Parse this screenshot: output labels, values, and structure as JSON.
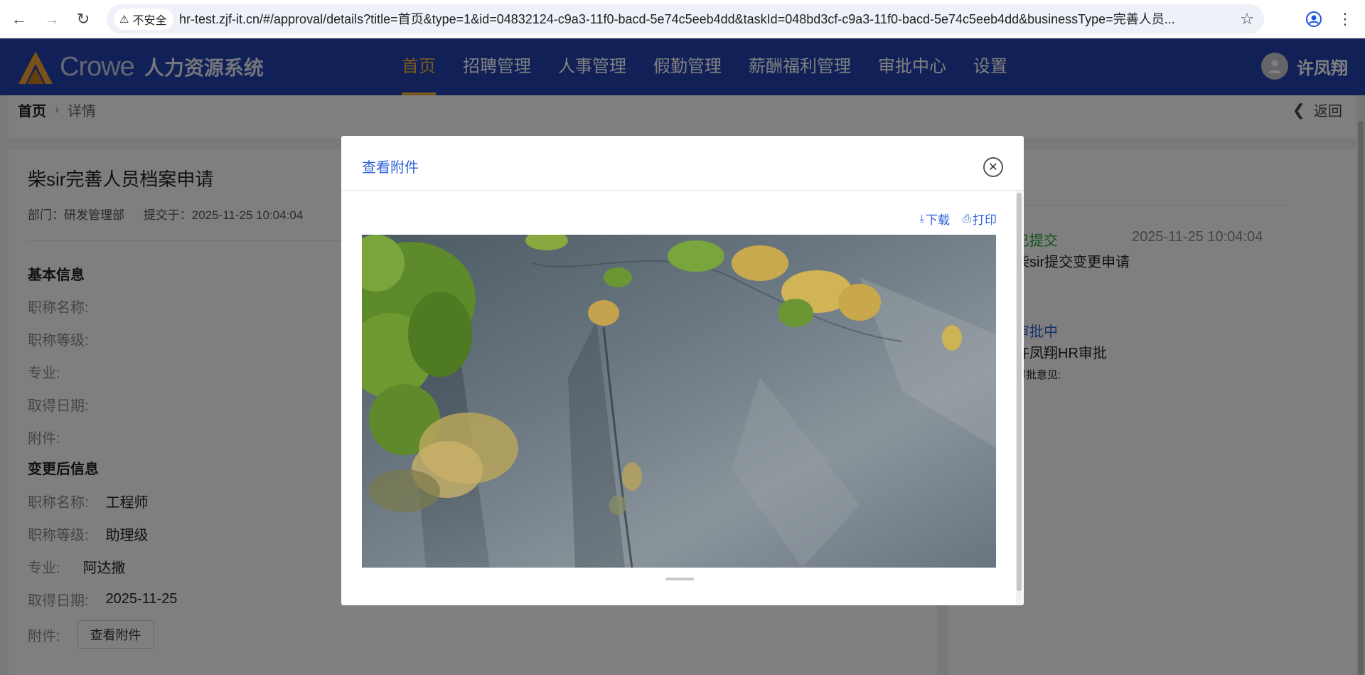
{
  "browser": {
    "security_label": "不安全",
    "url": "hr-test.zjf-it.cn/#/approval/details?title=首页&type=1&id=04832124-c9a3-11f0-bacd-5e74c5eeb4dd&taskId=048bd3cf-c9a3-11f0-bacd-5e74c5eeb4dd&businessType=完善人员..."
  },
  "app": {
    "brand": "Crowe",
    "system_name": "人力资源系统",
    "nav": [
      {
        "label": "首页",
        "active": true
      },
      {
        "label": "招聘管理"
      },
      {
        "label": "人事管理"
      },
      {
        "label": "假勤管理"
      },
      {
        "label": "薪酬福利管理"
      },
      {
        "label": "审批中心"
      },
      {
        "label": "设置"
      }
    ],
    "user_name": "许凤翔",
    "accent": "#2341ae",
    "active_color": "#f0b53b"
  },
  "breadcrumb": {
    "home": "首页",
    "current": "详情",
    "back": "返回"
  },
  "request": {
    "title": "柴sir完善人员档案申请",
    "department": "部门：研发管理部",
    "submitted": "提交于：2025-11-25 10:04:04",
    "basic_title": "基本信息",
    "basic_fields": {
      "title_name": "职称名称:",
      "title_level": "职称等级:",
      "major": "专业:",
      "date": "取得日期:",
      "attachment": "附件:"
    },
    "changed_title": "变更后信息",
    "changed_fields": {
      "title_name_label": "职称名称:",
      "title_name_value": "工程师",
      "title_level_label": "职称等级:",
      "title_level_value": "助理级",
      "major_label": "专业:",
      "major_value": "阿达撒",
      "date_label": "取得日期:",
      "date_value": "2025-11-25",
      "attachment_label": "附件:",
      "attachment_button": "查看附件"
    }
  },
  "timeline": {
    "step1_status": "已提交",
    "step1_time": "2025-11-25 10:04:04",
    "step1_desc": "柴sir提交变更申请",
    "step2_status": "审批中",
    "step2_desc": "许凤翔HR审批",
    "step2_opinion": "审批意见:"
  },
  "modal": {
    "title": "查看附件",
    "download": "下载",
    "print": "打印",
    "close_icon": "close-icon",
    "image_desc_icon": "attachment-image"
  }
}
